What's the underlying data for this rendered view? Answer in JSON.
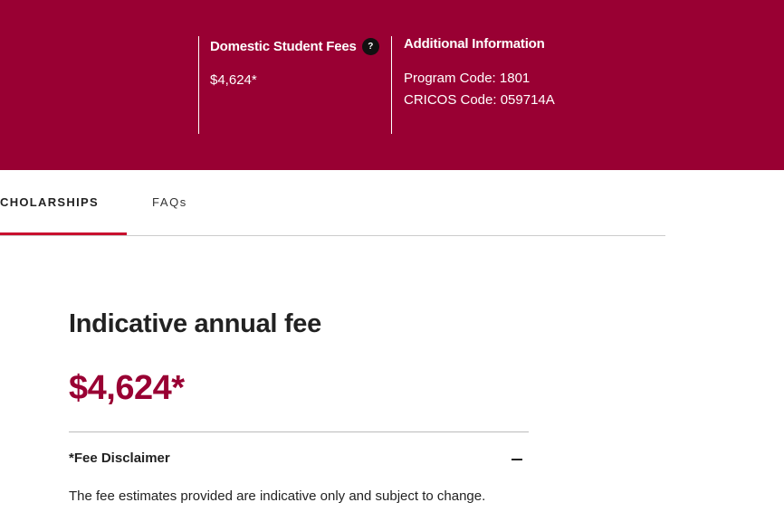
{
  "header": {
    "fees_title": "Domestic Student Fees",
    "help_glyph": "?",
    "fees_value": "$4,624*",
    "info_title": "Additional Information",
    "program_code": "Program Code: 1801",
    "cricos_code": "CRICOS Code: 059714A"
  },
  "tabs": [
    {
      "label": "CHOLARSHIPS",
      "active": true
    },
    {
      "label": "FAQs",
      "active": false
    }
  ],
  "main": {
    "heading": "Indicative annual fee",
    "amount": "$4,624*",
    "disclaimer_title": "*Fee Disclaimer",
    "disclaimer_text": "The fee estimates provided are indicative only and subject to change."
  },
  "icons": {
    "help": "question-circle-icon",
    "collapse": "minus-icon"
  },
  "colors": {
    "brand": "#990033",
    "tab_underline": "#c8102e"
  }
}
